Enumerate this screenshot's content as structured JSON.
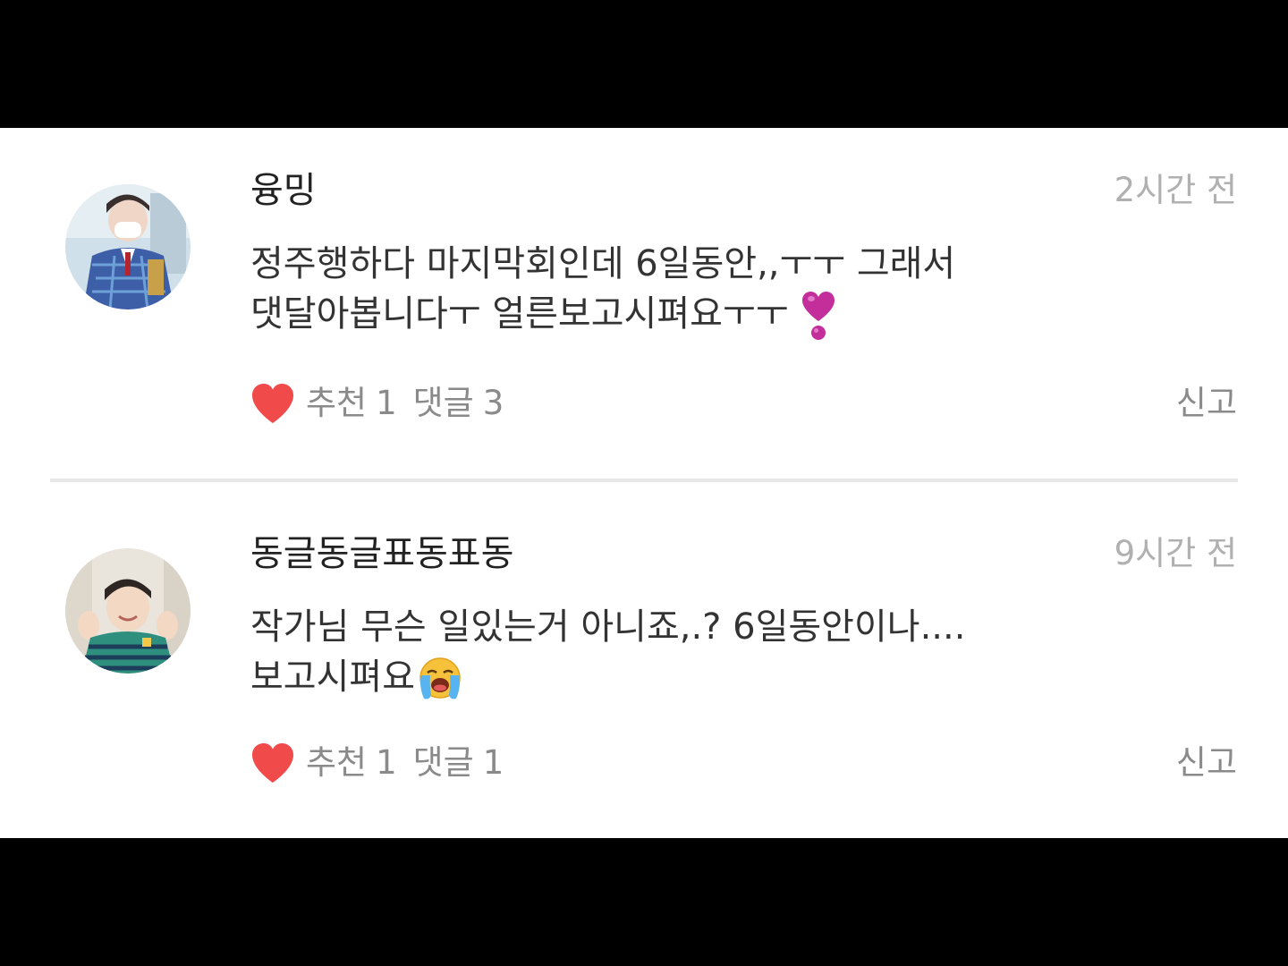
{
  "colors": {
    "letterbox": "#000000",
    "background": "#ffffff",
    "username": "#222222",
    "body_text": "#333333",
    "meta_text": "#8a8a8a",
    "timestamp": "#b0b0b0",
    "heart": "#f04a4a",
    "divider": "#e8e8e8"
  },
  "comments": [
    {
      "username": "융밍",
      "timestamp": "2시간 전",
      "body_lines": [
        "정주행하다 마지막회인데 6일동안,,ㅜㅜ 그래서",
        "댓달아봅니다ㅜ 얼른보고시펴요ㅜㅜ"
      ],
      "emoji": "heart-exclamation-icon",
      "like_label": "추천",
      "like_count": "1",
      "reply_label": "댓글",
      "reply_count": "3",
      "report_label": "신고"
    },
    {
      "username": "동글동글표동표동",
      "timestamp": "9시간 전",
      "body_lines": [
        "작가님 무슨 일있는거 아니죠,.? 6일동안이나....",
        "보고시펴요"
      ],
      "emoji": "loudly-crying-face-icon",
      "like_label": "추천",
      "like_count": "1",
      "reply_label": "댓글",
      "reply_count": "1",
      "report_label": "신고"
    }
  ]
}
